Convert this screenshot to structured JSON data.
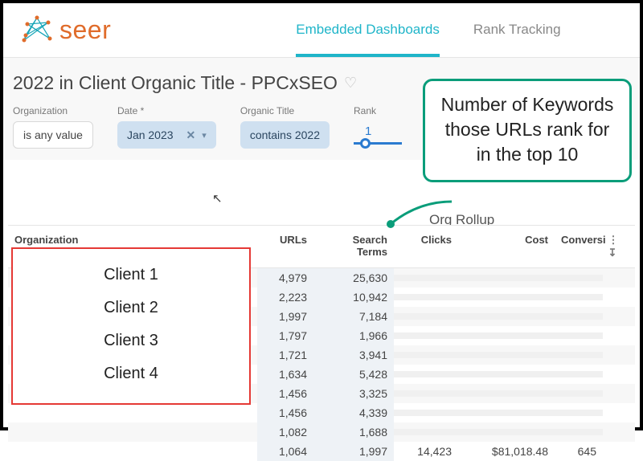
{
  "brand": {
    "name": "seer"
  },
  "nav": {
    "items": [
      {
        "label": "Embedded Dashboards",
        "active": true
      },
      {
        "label": "Rank Tracking",
        "active": false
      }
    ]
  },
  "page_title": "2022 in Client Organic Title - PPCxSEO",
  "filters": {
    "organization": {
      "label": "Organization",
      "value": "is any value"
    },
    "date": {
      "label": "Date *",
      "value": "Jan 2023"
    },
    "organic_title": {
      "label": "Organic Title",
      "value": "contains 2022"
    },
    "rank": {
      "label": "Rank",
      "value": "1"
    }
  },
  "section_label": "Org Rollup",
  "columns": {
    "organization": "Organization",
    "urls": "URLs",
    "search_terms": "Search Terms",
    "clicks": "Clicks",
    "cost": "Cost",
    "conversions": "Conversi"
  },
  "rows": [
    {
      "urls": "4,979",
      "terms": "25,630",
      "clicks": "",
      "cost": "",
      "conv": ""
    },
    {
      "urls": "2,223",
      "terms": "10,942",
      "clicks": "",
      "cost": "",
      "conv": ""
    },
    {
      "urls": "1,997",
      "terms": "7,184",
      "clicks": "",
      "cost": "",
      "conv": ""
    },
    {
      "urls": "1,797",
      "terms": "1,966",
      "clicks": "",
      "cost": "",
      "conv": ""
    },
    {
      "urls": "1,721",
      "terms": "3,941",
      "clicks": "",
      "cost": "",
      "conv": ""
    },
    {
      "urls": "1,634",
      "terms": "5,428",
      "clicks": "",
      "cost": "",
      "conv": ""
    },
    {
      "urls": "1,456",
      "terms": "3,325",
      "clicks": "",
      "cost": "",
      "conv": ""
    },
    {
      "urls": "1,456",
      "terms": "4,339",
      "clicks": "",
      "cost": "",
      "conv": ""
    },
    {
      "urls": "1,082",
      "terms": "1,688",
      "clicks": "",
      "cost": "",
      "conv": ""
    },
    {
      "urls": "1,064",
      "terms": "1,997",
      "clicks": "14,423",
      "cost": "$81,018.48",
      "conv": "645"
    }
  ],
  "clients_overlay": [
    "Client 1",
    "Client 2",
    "Client 3",
    "Client 4"
  ],
  "callout_text": "Number of Keywords those URLs rank for in the top 10"
}
